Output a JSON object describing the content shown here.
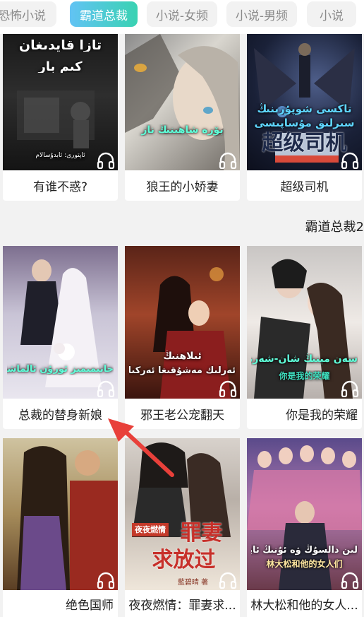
{
  "tabs": [
    {
      "label": "恐怖小说",
      "active": false
    },
    {
      "label": "霸道总裁",
      "active": true
    },
    {
      "label": "小说-女频",
      "active": false
    },
    {
      "label": "小说-男频",
      "active": false
    },
    {
      "label": "小说",
      "active": false
    }
  ],
  "section_top": {
    "books": [
      {
        "title": "有谁不惑?",
        "cover_text_1": "تازا قايدىغان",
        "cover_text_2": "كىم بار",
        "cover_text_3": "ئاپتورى: ئابدۇسالام"
      },
      {
        "title": "狼王的小娇妻",
        "cover_text_1": "بۆرە شاھىنىڭ ناز",
        "cover_text_2": "",
        "cover_text_3": ""
      },
      {
        "title": "超级司机",
        "cover_text_1": "تاكسى شوپۇرىنىڭ",
        "cover_text_2": "سىرلىق مۇساپىسى",
        "cover_text_3": "超级司机"
      }
    ]
  },
  "section_header": "霸道总裁2",
  "section_main": {
    "books": [
      {
        "title": "总裁的替身新娘",
        "cover_text_1": "خانىمىمىز ئورۇن ئالماشتۇرۇش"
      },
      {
        "title": "邪王老公宠翻天",
        "cover_text_1": "ئىلاھنىڭ",
        "cover_text_2": "ئەرلىك مەشۇقىغا ئەركىلىشى"
      },
      {
        "title": "你是我的荣耀",
        "cover_text_1": "سەن مېنىڭ شان-شەرىپىم",
        "cover_text_2": "你是我的荣耀"
      },
      {
        "title": "绝色国师"
      },
      {
        "title": "夜夜燃情：罪妻求...",
        "cover_text_1": "罪妻",
        "cover_text_2": "求放过",
        "cover_text_3": "夜夜燃情",
        "cover_text_4": "藍碧晴 著"
      },
      {
        "title": "林大松和他的女人...",
        "cover_text_1": "لىن دالسۇڭ ۋە ئۇنىڭ ئاياللىرى",
        "cover_text_2": "林大松和他的女人们"
      }
    ]
  },
  "colors": {
    "accent_start": "#62c3f4",
    "accent_end": "#39d2b2",
    "arrow": "#e8403a"
  },
  "icons": {
    "headphone": "headphone-icon"
  }
}
